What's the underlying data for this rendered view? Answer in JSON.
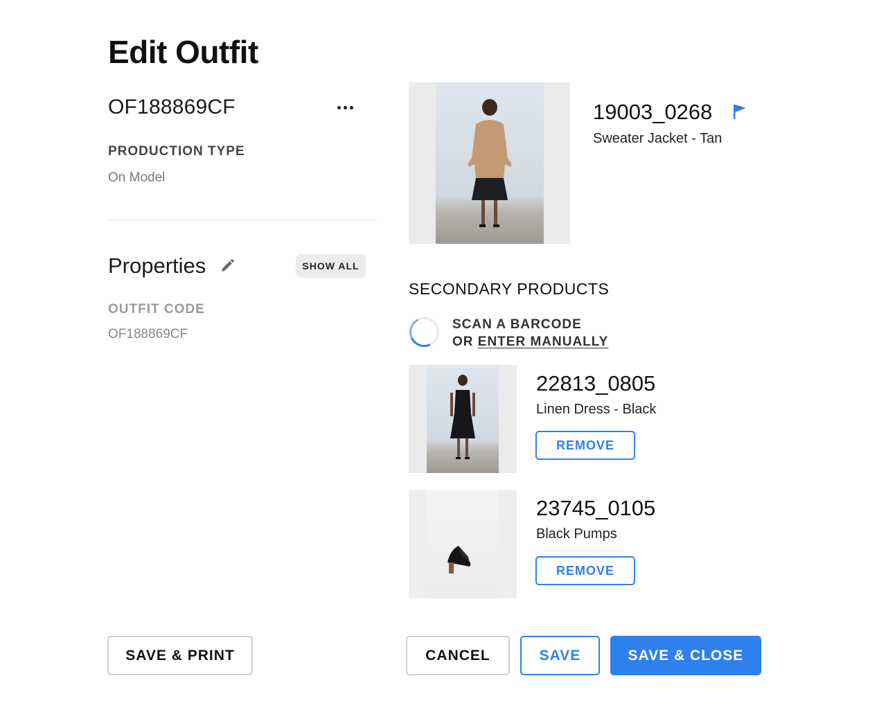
{
  "header": {
    "title": "Edit Outfit"
  },
  "outfit": {
    "id": "OF188869CF",
    "production_type_label": "PRODUCTION TYPE",
    "production_type_value": "On Model"
  },
  "properties": {
    "heading": "Properties",
    "show_all_label": "SHOW ALL",
    "outfit_code_label": "OUTFIT CODE",
    "outfit_code_value": "OF188869CF"
  },
  "primary_product": {
    "sku": "19003_0268",
    "name": "Sweater Jacket - Tan"
  },
  "secondary": {
    "heading": "SECONDARY PRODUCTS",
    "scan_line1": "SCAN A BARCODE",
    "scan_or": "OR ",
    "enter_manually": "ENTER MANUALLY",
    "items": [
      {
        "sku": "22813_0805",
        "name": "Linen Dress - Black",
        "remove_label": "REMOVE"
      },
      {
        "sku": "23745_0105",
        "name": "Black Pumps",
        "remove_label": "REMOVE"
      }
    ]
  },
  "footer": {
    "save_print_label": "SAVE & PRINT",
    "cancel_label": "CANCEL",
    "save_label": "SAVE",
    "save_close_label": "SAVE & CLOSE"
  },
  "colors": {
    "accent": "#2f80ed",
    "divider": "#e6e6e6",
    "muted_text": "#9a9a9a"
  },
  "icons": [
    "more-horizontal-icon",
    "pencil-icon",
    "flag-icon",
    "loading-spinner-icon"
  ]
}
